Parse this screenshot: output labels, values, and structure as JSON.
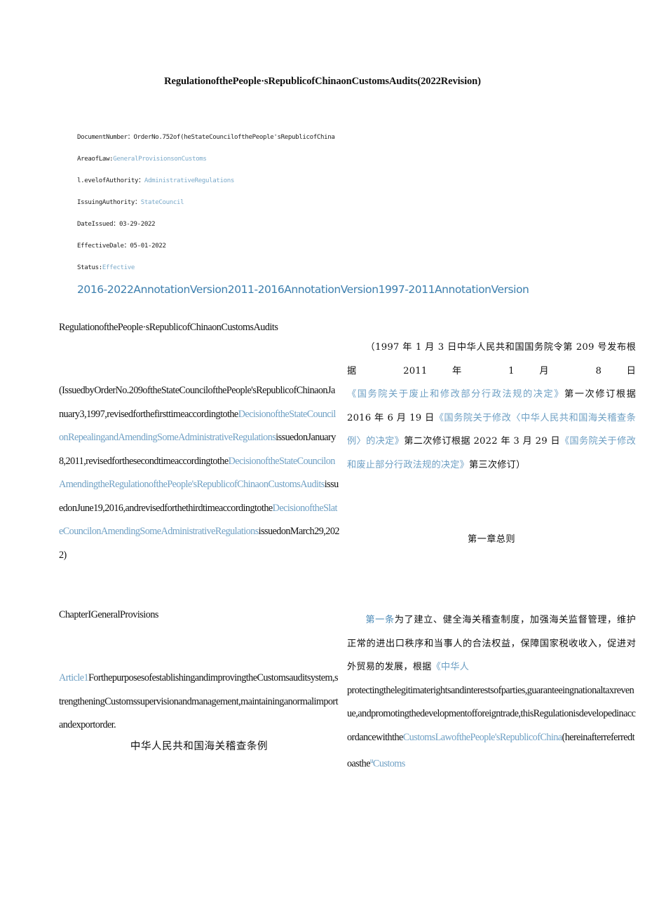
{
  "document": {
    "title": "RegulationofthePeople·sRepublicofChinaonCustomsAudits(2022Revision)"
  },
  "metadata": {
    "rows": [
      {
        "key": "DocumentNumber：",
        "value": "OrderNo.752of(heStateCouncilofthePeople'sRepublicofChina",
        "is_link": false
      },
      {
        "key": "AreaofLaw:",
        "value": "GeneralProvisionsonCustoms",
        "is_link": true
      },
      {
        "key": "l.evelofAuthority：",
        "value": "AdministrativeRegulations",
        "is_link": true
      },
      {
        "key": "IssuingAuthority：",
        "value": "StateCouncil",
        "is_link": true
      },
      {
        "key": "DateIssued：",
        "value": "03-29-2022",
        "is_link": false
      },
      {
        "key": "EffectiveDale：",
        "value": "05-01-2022",
        "is_link": false
      },
      {
        "key": "Status:",
        "value": "Effective",
        "is_link": true
      }
    ]
  },
  "annotation_versions": {
    "items": [
      {
        "label": "2016-2022AnnotationVersion"
      },
      {
        "label": "2011-2016AnnotationVersion"
      },
      {
        "label": "1997-2011AnnotationVersion"
      }
    ]
  },
  "left_column": {
    "title": "RegulationofthePeople·sRepublicofChinaonCustomsAudits",
    "preamble": {
      "seg1": "(IssuedbyOrderNo.209oftheStateCouncilofthePeople'sRepublicofChinaonJanuary3,1997,revisedforthefirsttimeaccordingtothe",
      "link1": "DecisionoftheStateCouncilonRepealingandAmendingSomeAdministrativeRegulations",
      "seg2": "issuedonJanuary8,2011,revisedforthesecondtimeaccordingtothe",
      "link2": "DecisionoftheStateCouncilonAmendingtheRegulationofthePeople'sRepublicofChinaonCustomsAudits",
      "seg3": "issuedonJune19,2016,andrevisedforthethirdtimeaccordingtothe",
      "link3": "DecisionoftheSlateCouncilonAmendingSomeAdministrativeRegulations",
      "seg4": "issuedonMarch29,2022)"
    },
    "chapter_heading": "ChapterIGeneralProvisions",
    "article1": {
      "link": "Article1",
      "text": "ForthepurposesofestablishingandimprovingtheCustomsauditsystem,strengtheningCustomssupervisionandmanagement,maintaininganormalimportandexportorder."
    },
    "chinese_title": "中华人民共和国海关稽查条例"
  },
  "right_column": {
    "preamble": {
      "seg1": "（1997 年 1 月 3 日中华人民共和国国务院令第 209 号发布根据 2011 年 1 月 8 日",
      "link1": "《国务院关于废止和修改部分行政法规的决定》",
      "seg2": "第一次修订根据 2016 年 6 月 19 日",
      "link2": "《国务院关于修改〈中华人民共和国海关稽查条例〉的决定》",
      "seg3": "第二次修订根据 2022 年 3 月 29 日",
      "link3": "《国务院关于修改和废止部分行政法规的决定》",
      "seg4": "第三次修订）"
    },
    "chapter_heading": "第一章总则",
    "article1": {
      "link": "第一条",
      "zh_text": "为了建立、健全海关稽查制度，加强海关监督管理，维护正常的进出口秩序和当事人的合法权益，保障国家税收收入，促进对外贸易的发展，根据",
      "zh_link_partial": "《中华人",
      "en_text": "protectingthelegitimaterightsandinterestsofparties,guaranteeingnationaltaxrevenue,andpromotingthedevelopmentofforeigntrade,thisRegulationisdevelopedinaccordancewiththe",
      "en_link": "CustomsLawofthePeople'sRepublicofChina",
      "en_after": "(hereinafterreferredtoasthe",
      "sup": "u",
      "en_tail_link": "Customs"
    }
  },
  "colors": {
    "link_blue": "#6fa0c4",
    "anno_blue": "#3d7fae",
    "meta_link_blue": "#7aa9c9",
    "text_black": "#111111",
    "background": "#ffffff"
  }
}
